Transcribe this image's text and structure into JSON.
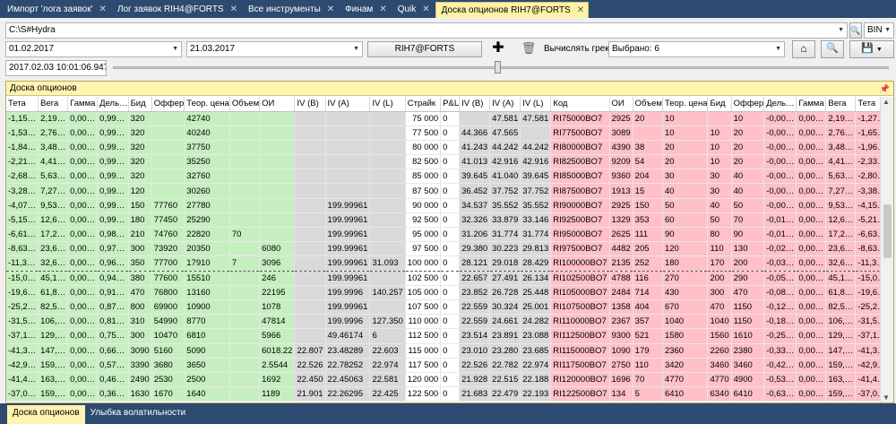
{
  "tabs": [
    {
      "label": "Импорт 'лога заявок'",
      "active": false
    },
    {
      "label": "Лог заявок RIH4@FORTS",
      "active": false
    },
    {
      "label": "Все инструменты",
      "active": false
    },
    {
      "label": "Финам",
      "active": false
    },
    {
      "label": "Quik",
      "active": false
    },
    {
      "label": "Доска опционов RIH7@FORTS",
      "active": true
    }
  ],
  "path": {
    "value": "C:\\S#Hydra",
    "format": "BIN"
  },
  "dates": {
    "from": "01.02.2017",
    "to": "21.03.2017"
  },
  "security_button": "RIH7@FORTS",
  "greeks": {
    "label": "Вычислять греки:",
    "value": "Выбрано: 6"
  },
  "timestamp": "2017.02.03 10:01:06.947",
  "panel_title": "Доска опционов",
  "columns": [
    "Тета",
    "Вега",
    "Гамма",
    "Дель…",
    "Бид",
    "Оффер",
    "Теор. цена",
    "Объем",
    "ОИ",
    "IV (B)",
    "IV (A)",
    "IV (L)",
    "Страйк",
    "P&L",
    "IV (B)",
    "IV (A)",
    "IV (L)",
    "Код",
    "ОИ",
    "Объем",
    "Теор. цена",
    "Бид",
    "Оффер",
    "Дель…",
    "Гамма",
    "Вега",
    "Тета"
  ],
  "rows": [
    [
      "-1,15…",
      "2,19…",
      "0,00…",
      "0,99…",
      "320",
      "",
      "42740",
      "",
      "",
      "",
      "",
      "",
      "75 000",
      "0",
      "",
      "47.581",
      "47.581",
      "RI75000BO7",
      "2925",
      "20",
      "10",
      "",
      "10",
      "-0,00…",
      "0,00…",
      "2,19…",
      "-1,27…"
    ],
    [
      "-1,53…",
      "2,76…",
      "0,00…",
      "0,99…",
      "320",
      "",
      "40240",
      "",
      "",
      "",
      "",
      "",
      "77 500",
      "0",
      "44.366",
      "47.565",
      "",
      "RI77500BO7",
      "3089",
      "",
      "10",
      "10",
      "20",
      "-0,00…",
      "0,00…",
      "2,76…",
      "-1,65…"
    ],
    [
      "-1,84…",
      "3,48…",
      "0,00…",
      "0,99…",
      "320",
      "",
      "37750",
      "",
      "",
      "",
      "",
      "",
      "80 000",
      "0",
      "41.243",
      "44.242",
      "44.242",
      "RI80000BO7",
      "4390",
      "38",
      "20",
      "10",
      "20",
      "-0,00…",
      "0,00…",
      "3,48…",
      "-1,96…"
    ],
    [
      "-2,21…",
      "4,41…",
      "0,00…",
      "0,99…",
      "320",
      "",
      "35250",
      "",
      "",
      "",
      "",
      "",
      "82 500",
      "0",
      "41.013",
      "42.916",
      "42.916",
      "RI82500BO7",
      "9209",
      "54",
      "20",
      "10",
      "20",
      "-0,00…",
      "0,00…",
      "4,41…",
      "-2,33…"
    ],
    [
      "-2,68…",
      "5,63…",
      "0,00…",
      "0,99…",
      "320",
      "",
      "32760",
      "",
      "",
      "",
      "",
      "",
      "85 000",
      "0",
      "39.645",
      "41.040",
      "39.645",
      "RI85000BO7",
      "9360",
      "204",
      "30",
      "30",
      "40",
      "-0,00…",
      "0,00…",
      "5,63…",
      "-2,80…"
    ],
    [
      "-3,28…",
      "7,27…",
      "0,00…",
      "0,99…",
      "120",
      "",
      "30260",
      "",
      "",
      "",
      "",
      "",
      "87 500",
      "0",
      "36.452",
      "37.752",
      "37.752",
      "RI87500BO7",
      "1913",
      "15",
      "40",
      "30",
      "40",
      "-0,00…",
      "0,00…",
      "7,27…",
      "-3,38…"
    ],
    [
      "-4,07…",
      "9,53…",
      "0,00…",
      "0,99…",
      "150",
      "77760",
      "27780",
      "",
      "",
      "",
      "199.99961",
      "",
      "90 000",
      "0",
      "34.537",
      "35.552",
      "35.552",
      "RI90000BO7",
      "2925",
      "150",
      "50",
      "40",
      "50",
      "-0,00…",
      "0,00…",
      "9,53…",
      "-4,15…"
    ],
    [
      "-5,15…",
      "12,6…",
      "0,00…",
      "0,99…",
      "180",
      "77450",
      "25290",
      "",
      "",
      "",
      "199.99961",
      "",
      "92 500",
      "0",
      "32.326",
      "33.879",
      "33.146",
      "RI92500BO7",
      "1329",
      "353",
      "60",
      "50",
      "70",
      "-0,01…",
      "0,00…",
      "12,6…",
      "-5,21…"
    ],
    [
      "-6,61…",
      "17,2…",
      "0,00…",
      "0,98…",
      "210",
      "74760",
      "22820",
      "70",
      "",
      "",
      "199.99961",
      "",
      "95 000",
      "0",
      "31.206",
      "31.774",
      "31.774",
      "RI95000BO7",
      "2625",
      "111",
      "90",
      "80",
      "90",
      "-0,01…",
      "0,00…",
      "17,2…",
      "-6,63…"
    ],
    [
      "-8,63…",
      "23,6…",
      "0,00…",
      "0,97…",
      "300",
      "73920",
      "20350",
      "",
      "6080",
      "",
      "199.99961",
      "",
      "97 500",
      "0",
      "29.380",
      "30.223",
      "29.813",
      "RI97500BO7",
      "4482",
      "205",
      "120",
      "110",
      "130",
      "-0,02…",
      "0,00…",
      "23,6…",
      "-8,63…"
    ],
    [
      "-11,3…",
      "32,6…",
      "0,00…",
      "0,96…",
      "350",
      "77700",
      "17910",
      "7",
      "3096",
      "",
      "199.99961",
      "31.093",
      "100 000",
      "0",
      "28.121",
      "29.018",
      "28.429",
      "RI100000BO7",
      "2135",
      "252",
      "180",
      "170",
      "200",
      "-0,03…",
      "0,00…",
      "32,6…",
      "-11,3…"
    ],
    [
      "-15,0…",
      "45,1…",
      "0,00…",
      "0,94…",
      "380",
      "77600",
      "15510",
      "",
      "246",
      "",
      "199.99961",
      "",
      "102 500",
      "0",
      "22.657",
      "27.491",
      "26.134",
      "RI102500BO7",
      "4788",
      "116",
      "270",
      "200",
      "290",
      "-0,05…",
      "0,00…",
      "45,1…",
      "-15,0…"
    ],
    [
      "-19,6…",
      "61,8…",
      "0,00…",
      "0,91…",
      "470",
      "76800",
      "13160",
      "",
      "22195",
      "",
      "199.9996",
      "140.257",
      "105 000",
      "0",
      "23.852",
      "26.728",
      "25.448",
      "RI105000BO7",
      "2484",
      "714",
      "430",
      "300",
      "470",
      "-0,08…",
      "0,00…",
      "61,8…",
      "-19,6…"
    ],
    [
      "-25,2…",
      "82,5…",
      "0,00…",
      "0,87…",
      "800",
      "69900",
      "10900",
      "",
      "1078",
      "",
      "199.99961",
      "",
      "107 500",
      "0",
      "22.559",
      "30.324",
      "25.001",
      "RI107500BO7",
      "1358",
      "404",
      "670",
      "470",
      "1150",
      "-0,12…",
      "0,00…",
      "82,5…",
      "-25,2…"
    ],
    [
      "-31,5…",
      "106,…",
      "0,00…",
      "0,81…",
      "310",
      "54990",
      "8770",
      "",
      "47814",
      "",
      "199.9996",
      "127.350",
      "110 000",
      "0",
      "22.559",
      "24.661",
      "24.282",
      "RI110000BO7",
      "2367",
      "357",
      "1040",
      "1040",
      "1150",
      "-0,18…",
      "0,00…",
      "106,…",
      "-31,5…"
    ],
    [
      "-37,1…",
      "129,…",
      "0,00…",
      "0,75…",
      "300",
      "10470",
      "6810",
      "",
      "5966",
      "",
      "49.46174",
      "6",
      "112 500",
      "0",
      "23.514",
      "23.891",
      "23.088",
      "RI112500BO7",
      "9300",
      "521",
      "1580",
      "1560",
      "1610",
      "-0,25…",
      "0,00…",
      "129,…",
      "-37,1…"
    ],
    [
      "-41,3…",
      "147,…",
      "0,00…",
      "0,66…",
      "3090",
      "5160",
      "5090",
      "",
      "60",
      "6018.22",
      "22.807",
      "23.48289",
      "22.603",
      "115 000",
      "0",
      "23.010",
      "23.280",
      "23.685",
      "RI115000BO7",
      "1090",
      "179",
      "2360",
      "2260",
      "2380",
      "-0,33…",
      "0,00…",
      "147,…",
      "-41,3…"
    ],
    [
      "-42,9…",
      "159,…",
      "0,00…",
      "0,57…",
      "3390",
      "3680",
      "3650",
      "",
      "32",
      "2.5544",
      "22.526",
      "22.78252",
      "22.974",
      "117 500",
      "0",
      "22.526",
      "22.782",
      "22.974",
      "RI117500BO7",
      "2750",
      "110",
      "3420",
      "3460",
      "3460",
      "-0,42…",
      "0,00…",
      "159,…",
      "-42,9…"
    ],
    [
      "-41,4…",
      "163,…",
      "0,00…",
      "0,46…",
      "2490",
      "2530",
      "2500",
      "",
      "112",
      "1692",
      "22.450",
      "22.45063",
      "22.581",
      "120 000",
      "0",
      "21.928",
      "22.515",
      "22.188",
      "RI120000BO7",
      "1696",
      "70",
      "4770",
      "4770",
      "4900",
      "-0,53…",
      "0,00…",
      "163,…",
      "-41,4…"
    ],
    [
      "-37,0…",
      "159,…",
      "0,00…",
      "0,36…",
      "1630",
      "1670",
      "1640",
      "",
      "89",
      "1189",
      "21.901",
      "22.26295",
      "22.425",
      "122 500",
      "0",
      "21.683",
      "22.479",
      "22.193",
      "RI122500BO7",
      "134",
      "5",
      "6410",
      "6340",
      "6410",
      "-0,63…",
      "0,00…",
      "159,…",
      "-37,0…"
    ]
  ],
  "bottom_tabs": [
    {
      "label": "Доска опционов",
      "active": true
    },
    {
      "label": "Улыбка волатильности",
      "active": false
    }
  ]
}
